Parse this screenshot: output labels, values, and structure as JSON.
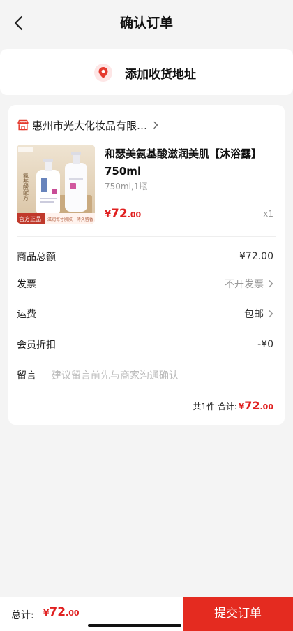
{
  "header": {
    "title": "确认订单"
  },
  "address": {
    "label": "添加收货地址"
  },
  "shop": {
    "name": "惠州市光大化妆品有限…"
  },
  "product": {
    "title": "和瑟美氨基酸滋润美肌【沐浴露】750ml",
    "spec": "750ml,1瓶",
    "price_symbol": "¥",
    "price_int": "72",
    "price_dec": ".00",
    "qty": "x1",
    "badge_official": "官方正品",
    "badge_tags": "滋润每寸肌肤 · 持久留香",
    "bottle_text": "氨基酸配方 温和不刺激"
  },
  "rows": {
    "subtotal_label": "商品总额",
    "subtotal_value": "¥72.00",
    "invoice_label": "发票",
    "invoice_value": "不开发票",
    "shipping_label": "运费",
    "shipping_value": "包邮",
    "discount_label": "会员折扣",
    "discount_value": "-¥0",
    "remark_label": "留言",
    "remark_placeholder": "建议留言前先与商家沟通确认"
  },
  "summary": {
    "count_text": "共1件 合计:",
    "price_symbol": "¥",
    "price_int": "72",
    "price_dec": ".00"
  },
  "bottom": {
    "total_label": "总计:",
    "price_symbol": "¥",
    "price_int": "72",
    "price_dec": ".00",
    "submit_label": "提交订单"
  },
  "colors": {
    "accent": "#e42b20",
    "price": "#e02020",
    "background": "#f4f4f4"
  },
  "icons": {
    "back": "chevron-left-icon",
    "location": "location-pin-icon",
    "shop": "store-icon",
    "chevron": "chevron-right-icon"
  }
}
